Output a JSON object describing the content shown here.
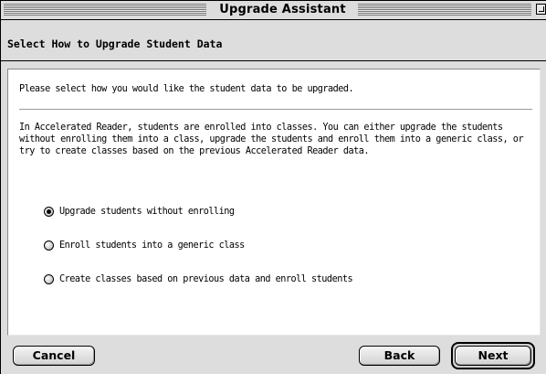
{
  "window": {
    "title": "Upgrade Assistant"
  },
  "header": {
    "title": "Select How to Upgrade Student Data"
  },
  "content": {
    "intro": "Please select how you would like the student data to be upgraded.",
    "description": "In Accelerated Reader, students are enrolled into classes.  You can either upgrade the students without enrolling them into a class, upgrade the students and enroll them into a generic class, or try to create classes based on the previous Accelerated Reader data.",
    "options": [
      {
        "label": "Upgrade students without enrolling",
        "selected": true
      },
      {
        "label": "Enroll students into a generic class",
        "selected": false
      },
      {
        "label": "Create classes based on previous data and enroll students",
        "selected": false
      }
    ]
  },
  "footer": {
    "cancel_label": "Cancel",
    "back_label": "Back",
    "next_label": "Next"
  }
}
